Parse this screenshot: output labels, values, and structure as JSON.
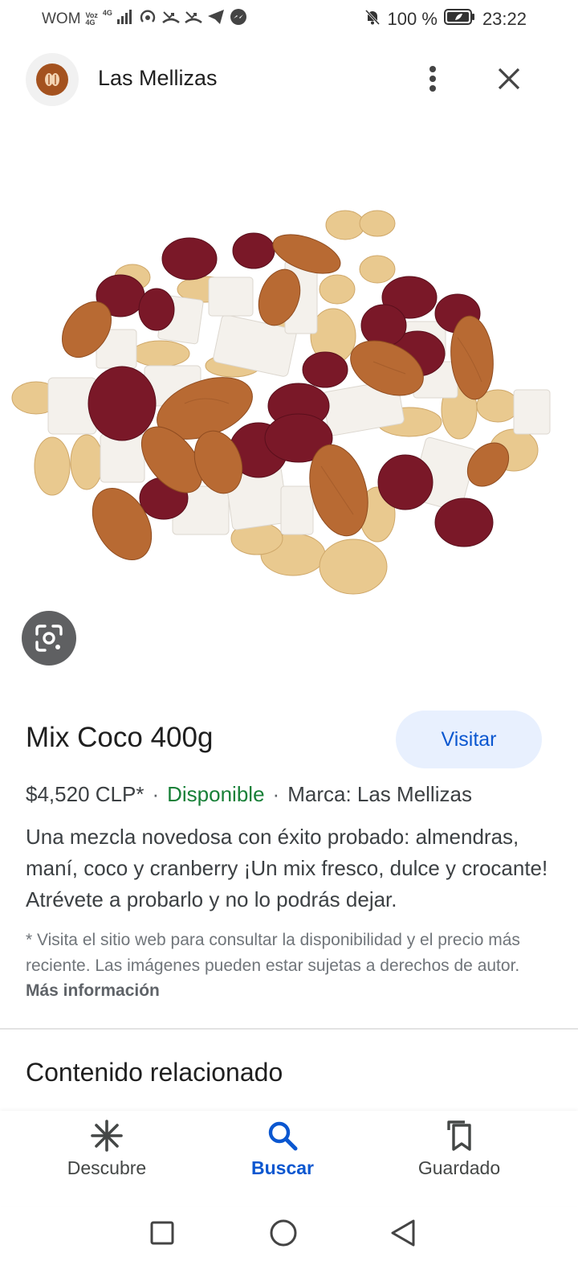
{
  "status_bar": {
    "carrier": "WOM",
    "voz": "Voz",
    "voz_sub": "4G",
    "net": "4G",
    "battery": "100 %",
    "time": "23:22"
  },
  "header": {
    "site_name": "Las Mellizas"
  },
  "product": {
    "title": "Mix Coco 400g",
    "visit_label": "Visitar",
    "price": "$4,520 CLP*",
    "availability": "Disponible",
    "brand": "Marca: Las Mellizas",
    "separator": "·",
    "description": "Una mezcla novedosa con éxito probado: almendras, maní, coco y cranberry ¡Un mix fresco, dulce y crocante! Atrévete a probarlo y no lo podrás dejar.",
    "disclaimer": "* Visita el sitio web para consultar la disponibilidad y el precio más reciente. Las imágenes pueden estar sujetas a derechos de autor.",
    "more_info": "Más información"
  },
  "related": {
    "heading": "Contenido relacionado"
  },
  "bottom_nav": {
    "items": [
      {
        "label": "Descubre",
        "icon": "asterisk-icon",
        "active": false
      },
      {
        "label": "Buscar",
        "icon": "search-icon",
        "active": true
      },
      {
        "label": "Guardado",
        "icon": "bookmarks-icon",
        "active": false
      }
    ]
  },
  "colors": {
    "accent": "#0b57d0",
    "available": "#188038",
    "visit_bg": "#e8f0fe"
  }
}
